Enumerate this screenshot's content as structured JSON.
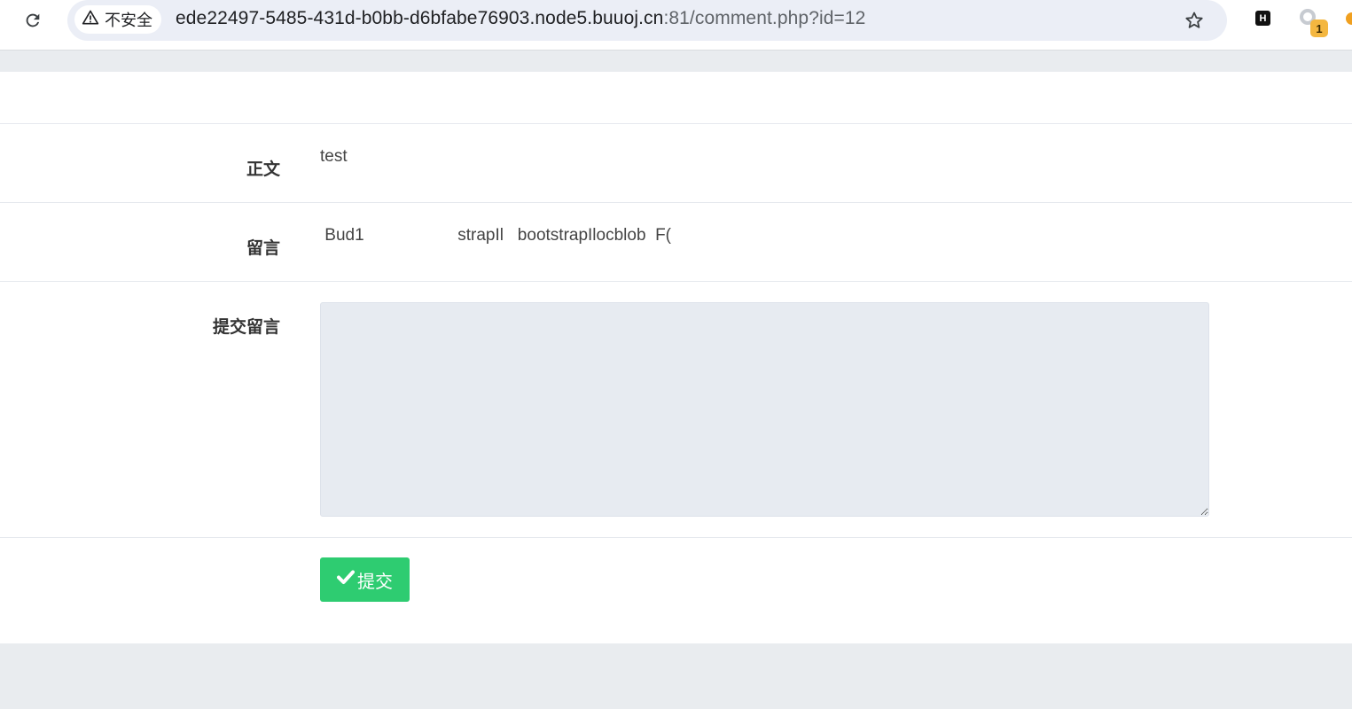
{
  "browser": {
    "security_label": "不安全",
    "url_host": "ede22497-5485-431d-b0bb-d6bfabe76903.node5.buuoj.cn",
    "url_path": ":81/comment.php?id=12",
    "extension_h_label": "H",
    "extension_badge_count": "1"
  },
  "post": {
    "body_label": "正文",
    "body_value": "test",
    "comment_label": "留言",
    "comment_value": " Bud1                    strapIl   bootstrapIlocblob  F(",
    "submit_label": "提交留言",
    "textarea_value": "",
    "button_label": "提交"
  },
  "colors": {
    "button_green": "#2ecc71",
    "textarea_bg": "#e7ebf1",
    "page_bg": "#e9ecef"
  },
  "icons": [
    "reload-icon",
    "warning-icon",
    "star-icon",
    "check-icon"
  ]
}
